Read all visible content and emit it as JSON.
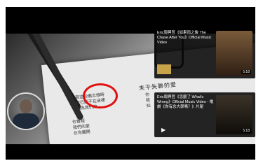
{
  "video": {
    "paper_title": "未干失聯的愛",
    "paragraph_left": "寫這份備忘錄時\n我已經不在這裡\n因為我們的",
    "paragraph_right": "你\n我\n知",
    "paragraph_bottom": "你曾經\n我們的愛\n在你離開"
  },
  "end_cards": [
    {
      "title": "Eric周興哲《如果雨之後 The Chase After You》Official Music Video",
      "duration": "5:18"
    },
    {
      "title": "Eric周興哲《怎麼了 What's Wrong》Official Music Video - 電劇《你有念大學嗎？》片尾",
      "duration": "5:18"
    }
  ]
}
